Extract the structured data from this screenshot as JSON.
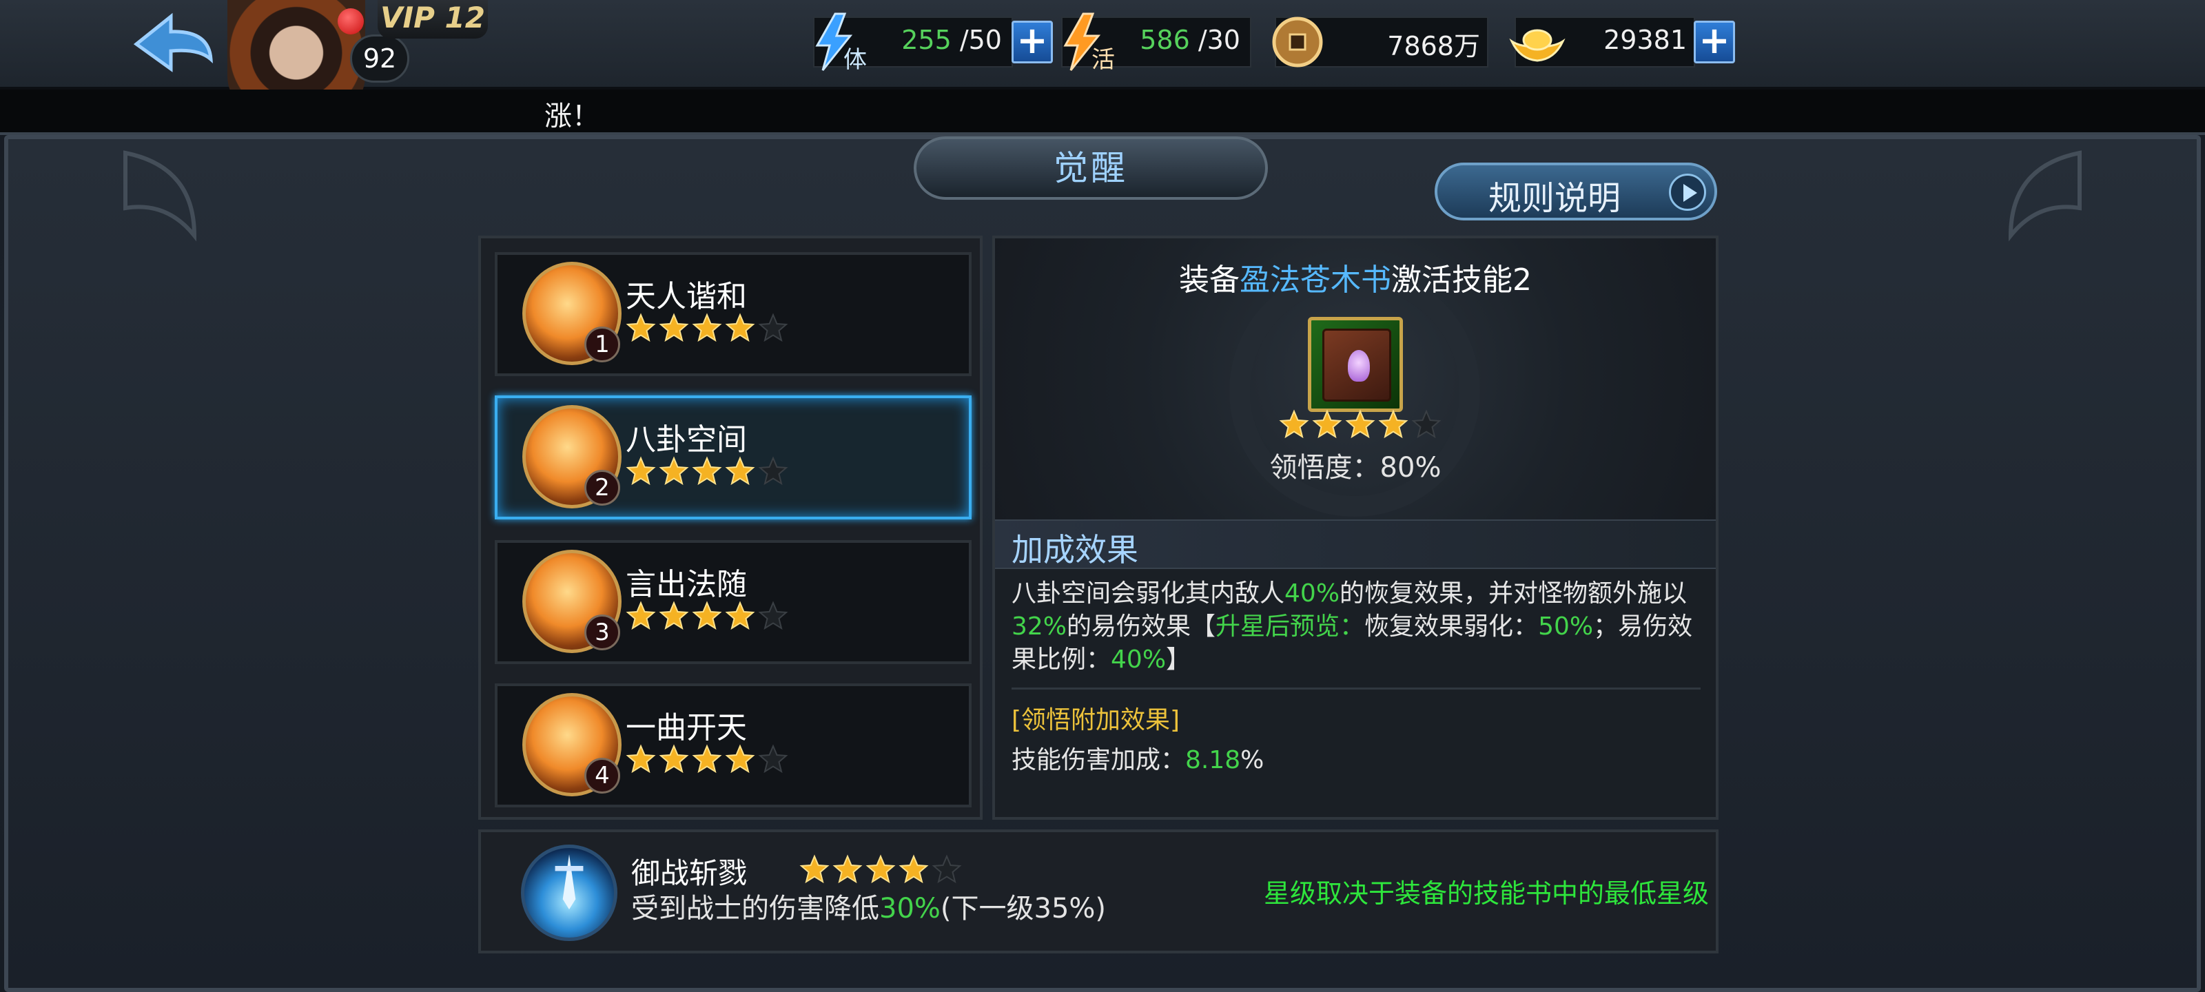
{
  "header": {
    "vip": "VIP 12",
    "level": "92",
    "resources": [
      {
        "name": "stamina",
        "icon": "lightning-ti-icon",
        "current": "255",
        "max": " /50"
      },
      {
        "name": "vitality",
        "icon": "lightning-huo-icon",
        "current": "586",
        "max": " /30"
      },
      {
        "name": "copper",
        "icon": "copper-coin-icon",
        "value": "7868万"
      },
      {
        "name": "ingot",
        "icon": "gold-ingot-icon",
        "value": "29381"
      }
    ],
    "plus_label": "+"
  },
  "marquee": {
    "text": "涨！"
  },
  "page": {
    "title": "觉醒",
    "rules_button": "规则说明"
  },
  "skills": [
    {
      "name": "天人谐和",
      "number": "1",
      "stars": 4,
      "max_stars": 5
    },
    {
      "name": "八卦空间",
      "number": "2",
      "stars": 4,
      "max_stars": 5,
      "selected": true
    },
    {
      "name": "言出法随",
      "number": "3",
      "stars": 4,
      "max_stars": 5
    },
    {
      "name": "一曲开天",
      "number": "4",
      "stars": 4,
      "max_stars": 5
    }
  ],
  "detail": {
    "equip_prefix": "装备",
    "book_name": "盈法苍木书",
    "equip_suffix": "激活技能2",
    "book_stars": 4,
    "book_max_stars": 5,
    "comprehension": "领悟度：80%",
    "bonus_title": "加成效果",
    "desc": {
      "p1": "八卦空间会弱化其内敌人",
      "v1": "40%",
      "p2": "的恢复效果，并对怪物额外施以",
      "v2": "32%",
      "p3": "的易伤效果【",
      "v3": "升星后预览：",
      "p4": "恢复效果弱化：",
      "v4": "50%",
      "p5": "；易伤效果比例：",
      "v5": "40%",
      "p6": "】"
    },
    "extra_title": "[领悟附加效果]",
    "extra_label": "技能伤害加成：",
    "extra_value": "8.18",
    "extra_unit": "%"
  },
  "passive": {
    "name": "御战斩戮",
    "stars": 4,
    "max_stars": 5,
    "desc_prefix": "受到战士的伤害降低",
    "desc_value": "30%",
    "desc_suffix": "(下一级35%)",
    "hint": "星级取决于装备的技能书中的最低星级"
  },
  "colors": {
    "accent_blue": "#3aaef0",
    "green_value": "#43d44b",
    "gold": "#f5b223",
    "yellow_title": "#ecc23b"
  }
}
